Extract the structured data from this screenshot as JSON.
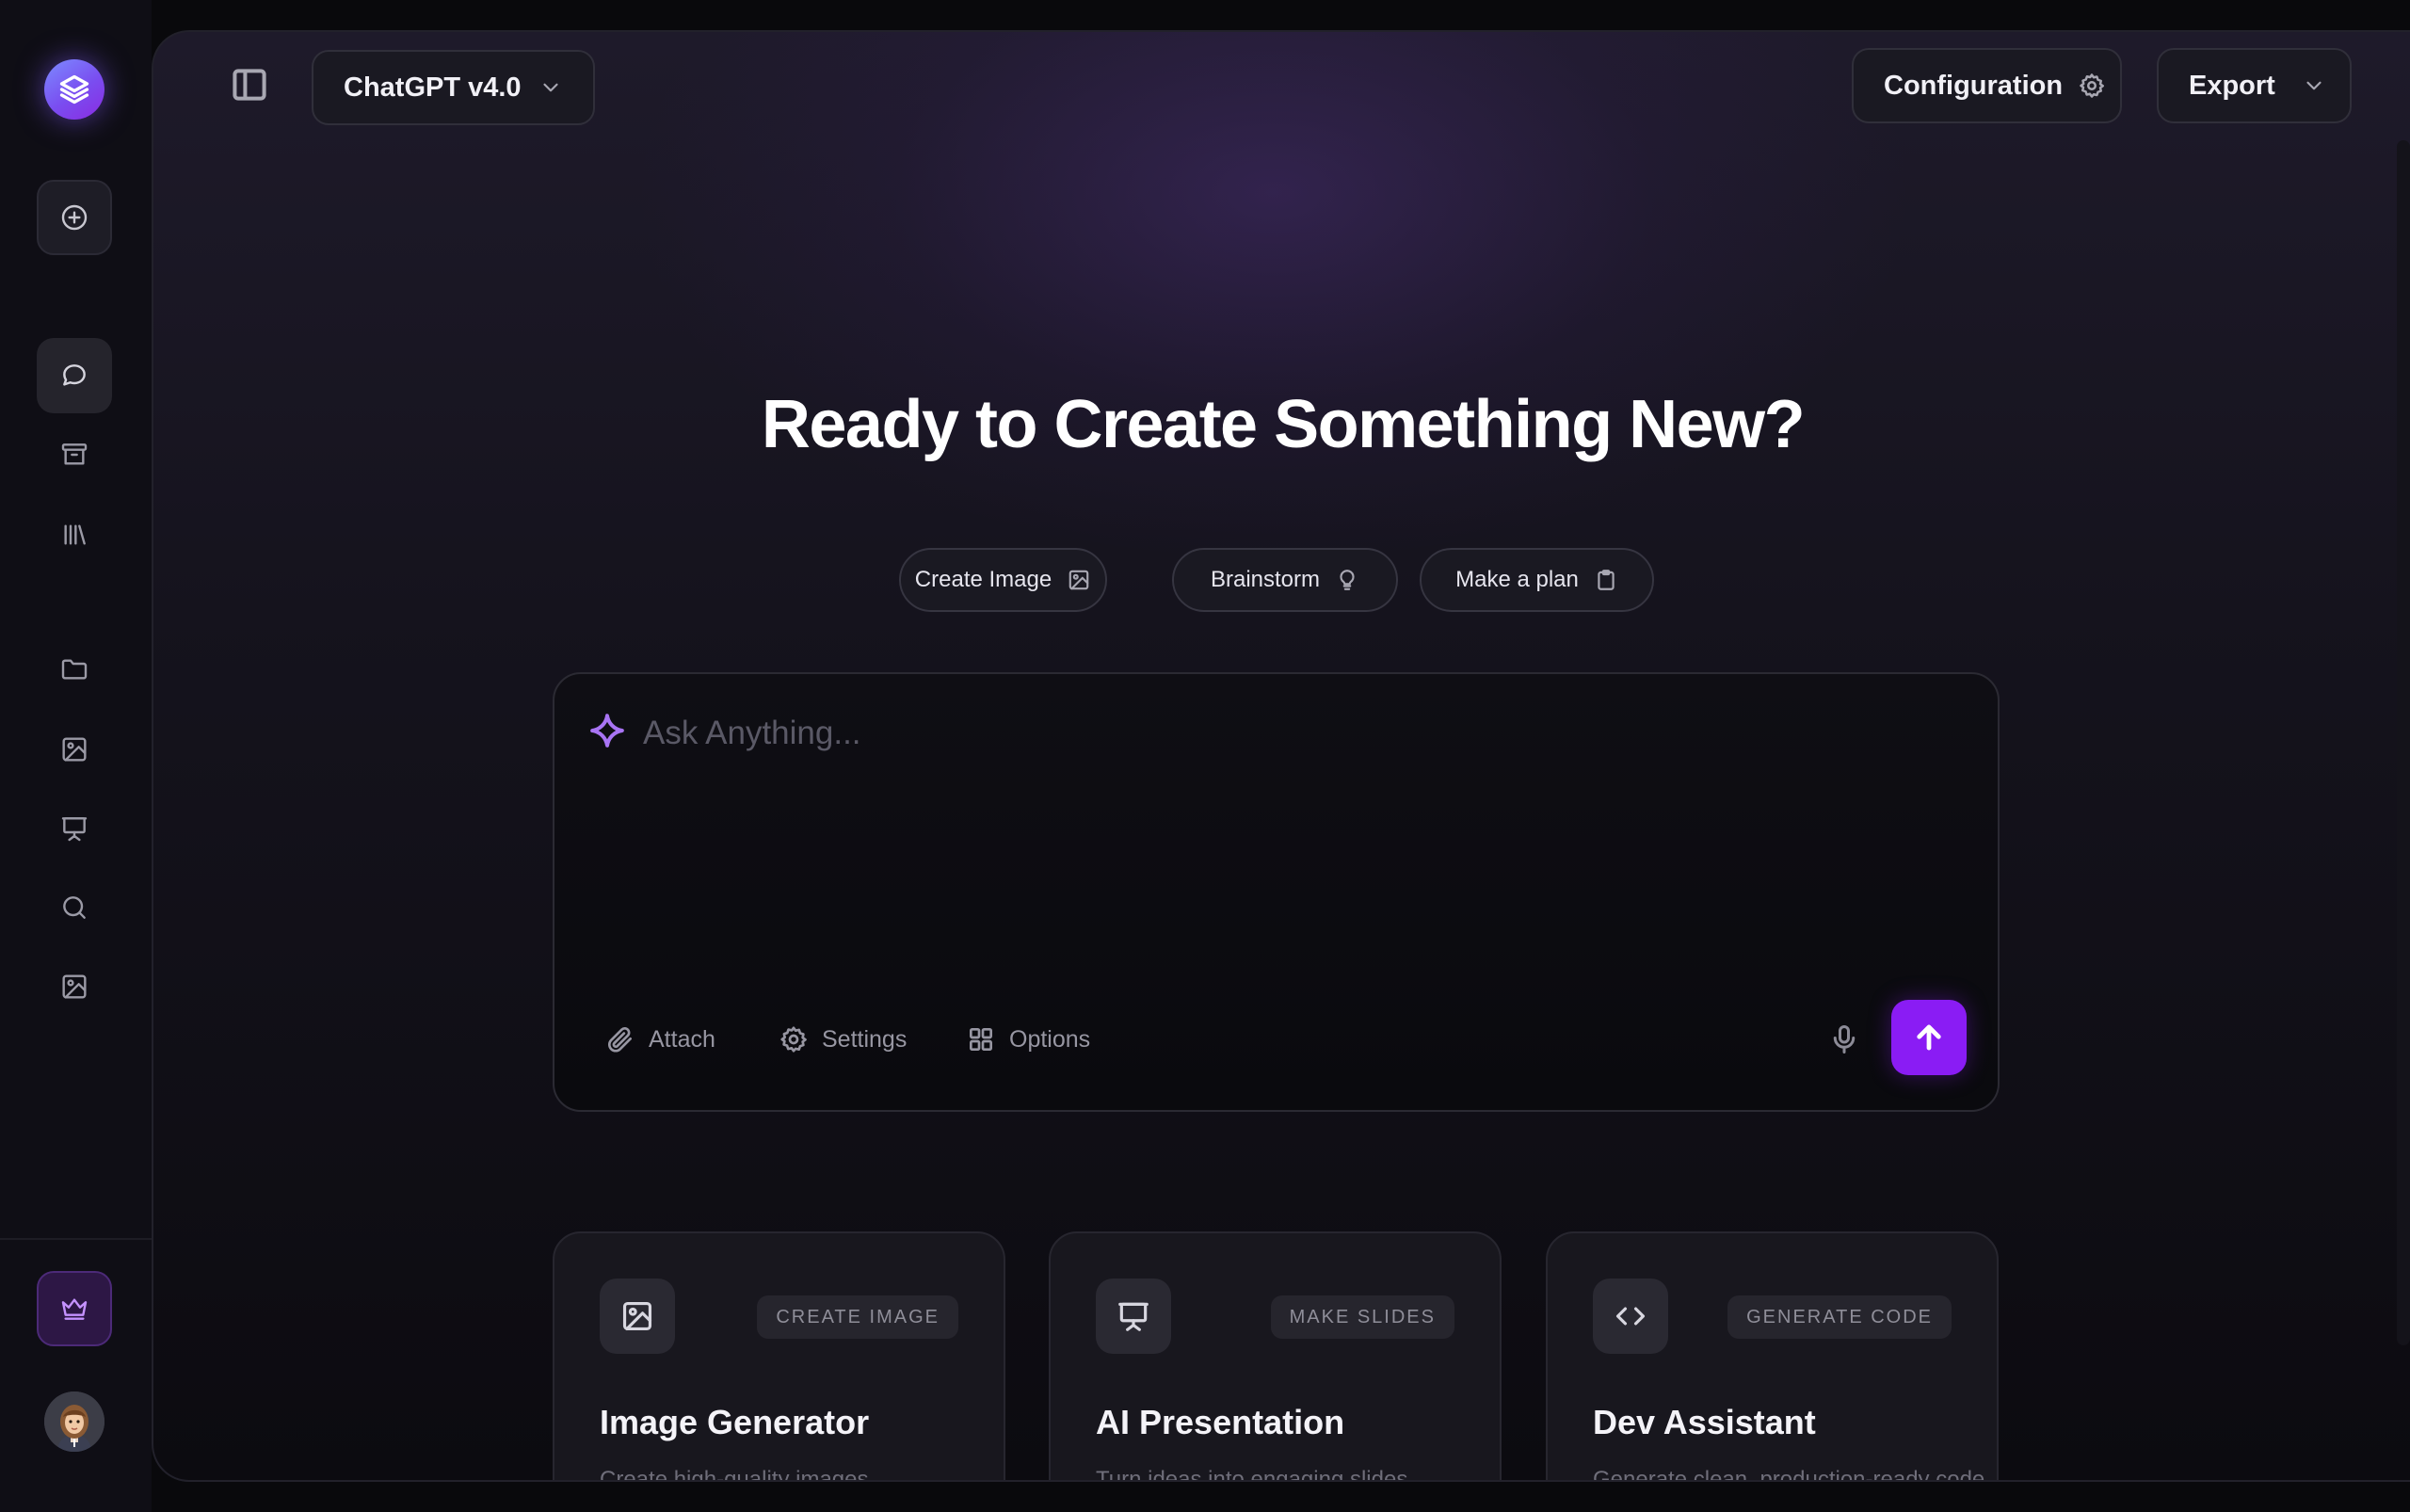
{
  "model_selector": {
    "label": "ChatGPT v4.0"
  },
  "header": {
    "configuration_label": "Configuration",
    "export_label": "Export"
  },
  "hero": {
    "title": "Ready to Create Something New?"
  },
  "chips": [
    {
      "label": "Create Image",
      "icon": "image-icon"
    },
    {
      "label": "Brainstorm",
      "icon": "lightbulb-icon"
    },
    {
      "label": "Make a plan",
      "icon": "clipboard-icon"
    }
  ],
  "composer": {
    "placeholder": "Ask Anything...",
    "value": "",
    "tools": [
      {
        "label": "Attach",
        "icon": "paperclip-icon"
      },
      {
        "label": "Settings",
        "icon": "gear-icon"
      },
      {
        "label": "Options",
        "icon": "grid-icon"
      }
    ]
  },
  "cards": [
    {
      "badge": "CREATE IMAGE",
      "title": "Image Generator",
      "description": "Create high-quality images",
      "icon": "image-icon"
    },
    {
      "badge": "MAKE SLIDES",
      "title": "AI Presentation",
      "description": "Turn ideas into engaging slides",
      "icon": "presentation-icon"
    },
    {
      "badge": "GENERATE CODE",
      "title": "Dev Assistant",
      "description": "Generate clean, production-ready code",
      "icon": "code-icon"
    }
  ],
  "colors": {
    "accent": "#8a1cf4",
    "sparkle": "#a874f4",
    "pro_badge": "#c592ff",
    "background": "#09090c"
  }
}
